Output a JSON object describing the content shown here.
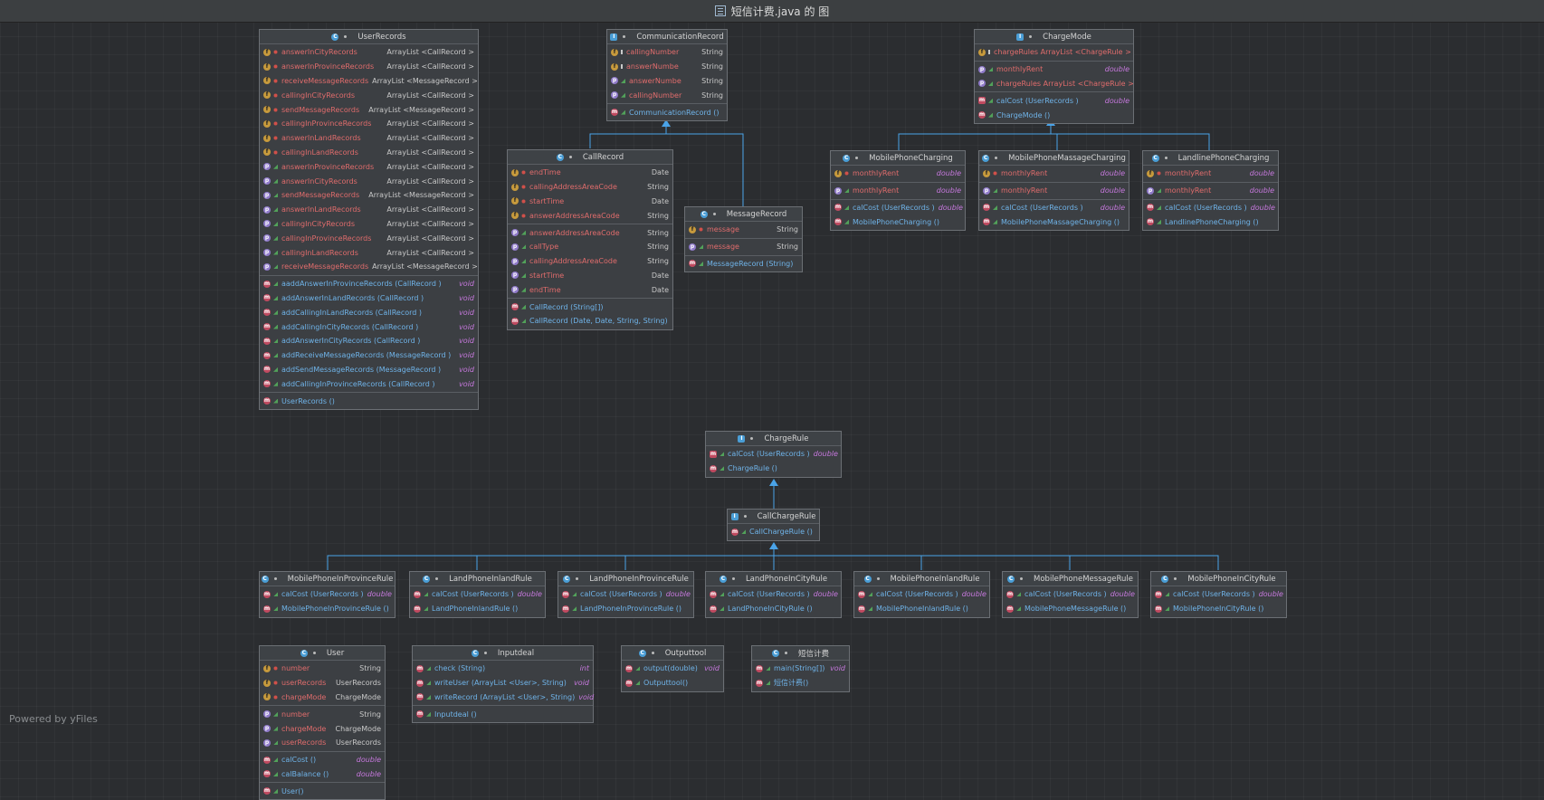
{
  "title": "短信计费.java 的 图",
  "watermark": "Powered by yFiles",
  "icon_names": {
    "f": "field-icon",
    "m": "method-icon",
    "p": "property-icon",
    "c": "class-icon",
    "i": "interface-icon",
    "a": "abstract-method-icon"
  },
  "classes": [
    {
      "id": "UserRecords",
      "name": "UserRecords",
      "kind": "c",
      "sections": [
        [
          [
            "f",
            "priv",
            "answerInCityRecords",
            "ArrayList <CallRecord >"
          ],
          [
            "f",
            "priv",
            "answerInProvinceRecords",
            "ArrayList <CallRecord >"
          ],
          [
            "f",
            "priv",
            "receiveMessageRecords",
            "ArrayList <MessageRecord >"
          ],
          [
            "f",
            "priv",
            "callingInCityRecords",
            "ArrayList <CallRecord >"
          ],
          [
            "f",
            "priv",
            "sendMessageRecords",
            "ArrayList <MessageRecord >"
          ],
          [
            "f",
            "priv",
            "callingInProvinceRecords",
            "ArrayList <CallRecord >"
          ],
          [
            "f",
            "priv",
            "answerInLandRecords",
            "ArrayList <CallRecord >"
          ],
          [
            "f",
            "priv",
            "callingInLandRecords",
            "ArrayList <CallRecord >"
          ],
          [
            "p",
            "pub",
            "answerInProvinceRecords",
            "ArrayList <CallRecord >"
          ],
          [
            "p",
            "pub",
            "answerInCityRecords",
            "ArrayList <CallRecord >"
          ],
          [
            "p",
            "pub",
            "sendMessageRecords",
            "ArrayList <MessageRecord >"
          ],
          [
            "p",
            "pub",
            "answerInLandRecords",
            "ArrayList <CallRecord >"
          ],
          [
            "p",
            "pub",
            "callingInCityRecords",
            "ArrayList <CallRecord >"
          ],
          [
            "p",
            "pub",
            "callingInProvinceRecords",
            "ArrayList <CallRecord >"
          ],
          [
            "p",
            "pub",
            "callingInLandRecords",
            "ArrayList <CallRecord >"
          ],
          [
            "p",
            "pub",
            "receiveMessageRecords",
            "ArrayList <MessageRecord >"
          ]
        ],
        [
          [
            "m",
            "pub",
            "aaddAnswerInProvinceRecords  (CallRecord )",
            "void"
          ],
          [
            "m",
            "pub",
            "addAnswerInLandRecords  (CallRecord )",
            "void"
          ],
          [
            "m",
            "pub",
            "addCallingInLandRecords  (CallRecord )",
            "void"
          ],
          [
            "m",
            "pub",
            "addCallingInCityRecords  (CallRecord )",
            "void"
          ],
          [
            "m",
            "pub",
            "addAnswerInCityRecords  (CallRecord )",
            "void"
          ],
          [
            "m",
            "pub",
            "addReceiveMessageRecords  (MessageRecord )",
            "void"
          ],
          [
            "m",
            "pub",
            "addSendMessageRecords  (MessageRecord )",
            "void"
          ],
          [
            "m",
            "pub",
            "addCallingInProvinceRecords  (CallRecord )",
            "void"
          ]
        ],
        [
          [
            "m",
            "pub",
            "UserRecords ()",
            ""
          ]
        ]
      ]
    },
    {
      "id": "CommunicationRecord",
      "name": "CommunicationRecord",
      "kind": "i",
      "sections": [
        [
          [
            "f",
            "pack",
            "callingNumber",
            "String"
          ],
          [
            "f",
            "pack",
            "answerNumbe",
            "String"
          ],
          [
            "p",
            "pub",
            "answerNumbe",
            "String"
          ],
          [
            "p",
            "pub",
            "callingNumber",
            "String"
          ]
        ],
        [
          [
            "m",
            "pub",
            "CommunicationRecord ()",
            ""
          ]
        ]
      ]
    },
    {
      "id": "ChargeMode",
      "name": "ChargeMode",
      "kind": "i",
      "sections": [
        [
          [
            "f",
            "pack",
            "chargeRules  ArrayList <ChargeRule >",
            ""
          ]
        ],
        [
          [
            "p",
            "pub",
            "monthlyRent",
            "double"
          ],
          [
            "p",
            "pub",
            "chargeRules  ArrayList <ChargeRule >",
            ""
          ]
        ],
        [
          [
            "a",
            "pub",
            "calCost (UserRecords )",
            "double"
          ],
          [
            "m",
            "pub",
            "ChargeMode  ()",
            ""
          ]
        ]
      ]
    },
    {
      "id": "CallRecord",
      "name": "CallRecord",
      "kind": "c",
      "sections": [
        [
          [
            "f",
            "priv",
            "endTime",
            "Date"
          ],
          [
            "f",
            "priv",
            "callingAddressAreaCode",
            "String"
          ],
          [
            "f",
            "priv",
            "startTime",
            "Date"
          ],
          [
            "f",
            "priv",
            "answerAddressAreaCode",
            "String"
          ]
        ],
        [
          [
            "p",
            "pub",
            "answerAddressAreaCode",
            "String"
          ],
          [
            "p",
            "pub",
            "callType",
            "String"
          ],
          [
            "p",
            "pub",
            "callingAddressAreaCode",
            "String"
          ],
          [
            "p",
            "pub",
            "startTime",
            "Date"
          ],
          [
            "p",
            "pub",
            "endTime",
            "Date"
          ]
        ],
        [
          [
            "m",
            "pub",
            "CallRecord  (String[])",
            ""
          ],
          [
            "m",
            "pub",
            "CallRecord  (Date, Date, String, String)",
            ""
          ]
        ]
      ]
    },
    {
      "id": "MessageRecord",
      "name": "MessageRecord",
      "kind": "c",
      "sections": [
        [
          [
            "f",
            "priv",
            "message",
            "String"
          ]
        ],
        [
          [
            "p",
            "pub",
            "message",
            "String"
          ]
        ],
        [
          [
            "m",
            "pub",
            "MessageRecord  (String)",
            ""
          ]
        ]
      ]
    },
    {
      "id": "MobilePhoneCharging",
      "name": "MobilePhoneCharging",
      "kind": "c",
      "sections": [
        [
          [
            "f",
            "priv",
            "monthlyRent",
            "double"
          ]
        ],
        [
          [
            "p",
            "pub",
            "monthlyRent",
            "double"
          ]
        ],
        [
          [
            "m",
            "pub",
            "calCost (UserRecords )",
            "double"
          ],
          [
            "m",
            "pub",
            "MobilePhoneCharging  ()",
            ""
          ]
        ]
      ]
    },
    {
      "id": "MobilePhoneMassageCharging",
      "name": "MobilePhoneMassageCharging",
      "kind": "c",
      "sections": [
        [
          [
            "f",
            "priv",
            "monthlyRent",
            "double"
          ]
        ],
        [
          [
            "p",
            "pub",
            "monthlyRent",
            "double"
          ]
        ],
        [
          [
            "m",
            "pub",
            "calCost (UserRecords )",
            "double"
          ],
          [
            "m",
            "pub",
            "MobilePhoneMassageCharging  ()",
            ""
          ]
        ]
      ]
    },
    {
      "id": "LandlinePhoneCharging",
      "name": "LandlinePhoneCharging",
      "kind": "c",
      "sections": [
        [
          [
            "f",
            "priv",
            "monthlyRent",
            "double"
          ]
        ],
        [
          [
            "p",
            "pub",
            "monthlyRent",
            "double"
          ]
        ],
        [
          [
            "m",
            "pub",
            "calCost (UserRecords )",
            "double"
          ],
          [
            "m",
            "pub",
            "LandlinePhoneCharging  ()",
            ""
          ]
        ]
      ]
    },
    {
      "id": "ChargeRule",
      "name": "ChargeRule",
      "kind": "i",
      "sections": [
        [
          [
            "a",
            "pub",
            "calCost (UserRecords )",
            "double"
          ],
          [
            "m",
            "pub",
            "ChargeRule  ()",
            ""
          ]
        ]
      ]
    },
    {
      "id": "CallChargeRule",
      "name": "CallChargeRule",
      "kind": "i",
      "sections": [
        [
          [
            "m",
            "pub",
            "CallChargeRule  ()",
            ""
          ]
        ]
      ]
    },
    {
      "id": "MobilePhoneInProvinceRule",
      "name": "MobilePhoneInProvinceRule",
      "kind": "c",
      "sections": [
        [
          [
            "m",
            "pub",
            "calCost (UserRecords )",
            "double"
          ],
          [
            "m",
            "pub",
            "MobilePhoneInProvinceRule  ()",
            ""
          ]
        ]
      ]
    },
    {
      "id": "LandPhoneInlandRule",
      "name": "LandPhoneInlandRule",
      "kind": "c",
      "sections": [
        [
          [
            "m",
            "pub",
            "calCost (UserRecords )",
            "double"
          ],
          [
            "m",
            "pub",
            "LandPhoneInlandRule  ()",
            ""
          ]
        ]
      ]
    },
    {
      "id": "LandPhoneInProvinceRule",
      "name": "LandPhoneInProvinceRule",
      "kind": "c",
      "sections": [
        [
          [
            "m",
            "pub",
            "calCost (UserRecords )",
            "double"
          ],
          [
            "m",
            "pub",
            "LandPhoneInProvinceRule  ()",
            ""
          ]
        ]
      ]
    },
    {
      "id": "LandPhoneInCityRule",
      "name": "LandPhoneInCityRule",
      "kind": "c",
      "sections": [
        [
          [
            "m",
            "pub",
            "calCost (UserRecords )",
            "double"
          ],
          [
            "m",
            "pub",
            "LandPhoneInCityRule  ()",
            ""
          ]
        ]
      ]
    },
    {
      "id": "MobilePhoneInlandRule",
      "name": "MobilePhoneInlandRule",
      "kind": "c",
      "sections": [
        [
          [
            "m",
            "pub",
            "calCost (UserRecords )",
            "double"
          ],
          [
            "m",
            "pub",
            "MobilePhoneInlandRule  ()",
            ""
          ]
        ]
      ]
    },
    {
      "id": "MobilePhoneMessageRule",
      "name": "MobilePhoneMessageRule",
      "kind": "c",
      "sections": [
        [
          [
            "m",
            "pub",
            "calCost (UserRecords )",
            "double"
          ],
          [
            "m",
            "pub",
            "MobilePhoneMessageRule  ()",
            ""
          ]
        ]
      ]
    },
    {
      "id": "MobilePhoneInCityRule",
      "name": "MobilePhoneInCityRule",
      "kind": "c",
      "sections": [
        [
          [
            "m",
            "pub",
            "calCost (UserRecords )",
            "double"
          ],
          [
            "m",
            "pub",
            "MobilePhoneInCityRule  ()",
            ""
          ]
        ]
      ]
    },
    {
      "id": "User",
      "name": "User",
      "kind": "c",
      "sections": [
        [
          [
            "f",
            "priv",
            "number",
            "String"
          ],
          [
            "f",
            "priv",
            "userRecords",
            "UserRecords"
          ],
          [
            "f",
            "priv",
            "chargeMode",
            "ChargeMode"
          ]
        ],
        [
          [
            "p",
            "pub",
            "number",
            "String"
          ],
          [
            "p",
            "pub",
            "chargeMode",
            "ChargeMode"
          ],
          [
            "p",
            "pub",
            "userRecords",
            "UserRecords"
          ]
        ],
        [
          [
            "m",
            "pub",
            "calCost ()",
            "double"
          ],
          [
            "m",
            "pub",
            "calBalance  ()",
            "double"
          ]
        ],
        [
          [
            "m",
            "pub",
            "User()",
            ""
          ]
        ]
      ]
    },
    {
      "id": "Inputdeal",
      "name": "Inputdeal",
      "kind": "c",
      "sections": [
        [
          [
            "m",
            "pub",
            "check (String)",
            "int"
          ],
          [
            "m",
            "pub",
            "writeUser (ArrayList <User>, String)",
            "void"
          ],
          [
            "m",
            "pub",
            "writeRecord (ArrayList <User>, String)",
            "void"
          ]
        ],
        [
          [
            "m",
            "pub",
            "Inputdeal ()",
            ""
          ]
        ]
      ]
    },
    {
      "id": "Outputtool",
      "name": "Outputtool",
      "kind": "c",
      "sections": [
        [
          [
            "m",
            "pub",
            "output(double)",
            "void"
          ],
          [
            "m",
            "pub",
            "Outputtool()",
            ""
          ]
        ]
      ]
    },
    {
      "id": "Main",
      "name": "短信计费",
      "kind": "c",
      "sections": [
        [
          [
            "m",
            "pub",
            "main(String[])",
            "void"
          ],
          [
            "m",
            "pub",
            "短信计费()",
            ""
          ]
        ]
      ]
    }
  ]
}
